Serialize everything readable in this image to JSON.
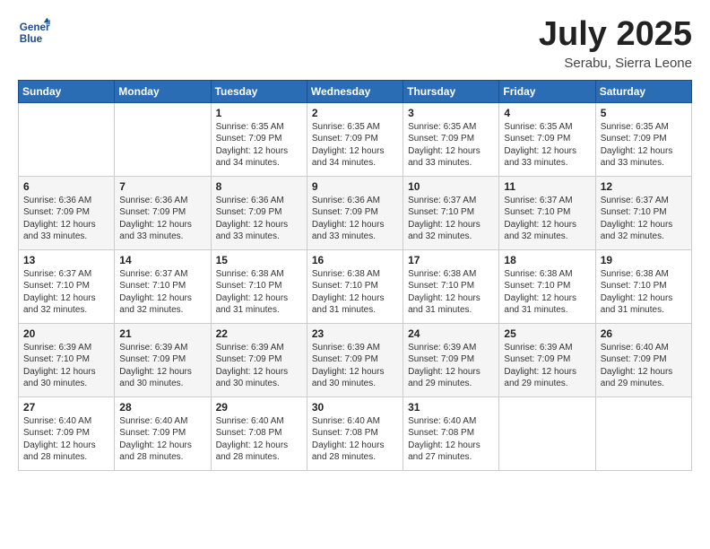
{
  "logo": {
    "line1": "General",
    "line2": "Blue"
  },
  "title": "July 2025",
  "location": "Serabu, Sierra Leone",
  "days_header": [
    "Sunday",
    "Monday",
    "Tuesday",
    "Wednesday",
    "Thursday",
    "Friday",
    "Saturday"
  ],
  "weeks": [
    [
      {
        "day": "",
        "sunrise": "",
        "sunset": "",
        "daylight": ""
      },
      {
        "day": "",
        "sunrise": "",
        "sunset": "",
        "daylight": ""
      },
      {
        "day": "1",
        "sunrise": "Sunrise: 6:35 AM",
        "sunset": "Sunset: 7:09 PM",
        "daylight": "Daylight: 12 hours and 34 minutes."
      },
      {
        "day": "2",
        "sunrise": "Sunrise: 6:35 AM",
        "sunset": "Sunset: 7:09 PM",
        "daylight": "Daylight: 12 hours and 34 minutes."
      },
      {
        "day": "3",
        "sunrise": "Sunrise: 6:35 AM",
        "sunset": "Sunset: 7:09 PM",
        "daylight": "Daylight: 12 hours and 33 minutes."
      },
      {
        "day": "4",
        "sunrise": "Sunrise: 6:35 AM",
        "sunset": "Sunset: 7:09 PM",
        "daylight": "Daylight: 12 hours and 33 minutes."
      },
      {
        "day": "5",
        "sunrise": "Sunrise: 6:35 AM",
        "sunset": "Sunset: 7:09 PM",
        "daylight": "Daylight: 12 hours and 33 minutes."
      }
    ],
    [
      {
        "day": "6",
        "sunrise": "Sunrise: 6:36 AM",
        "sunset": "Sunset: 7:09 PM",
        "daylight": "Daylight: 12 hours and 33 minutes."
      },
      {
        "day": "7",
        "sunrise": "Sunrise: 6:36 AM",
        "sunset": "Sunset: 7:09 PM",
        "daylight": "Daylight: 12 hours and 33 minutes."
      },
      {
        "day": "8",
        "sunrise": "Sunrise: 6:36 AM",
        "sunset": "Sunset: 7:09 PM",
        "daylight": "Daylight: 12 hours and 33 minutes."
      },
      {
        "day": "9",
        "sunrise": "Sunrise: 6:36 AM",
        "sunset": "Sunset: 7:09 PM",
        "daylight": "Daylight: 12 hours and 33 minutes."
      },
      {
        "day": "10",
        "sunrise": "Sunrise: 6:37 AM",
        "sunset": "Sunset: 7:10 PM",
        "daylight": "Daylight: 12 hours and 32 minutes."
      },
      {
        "day": "11",
        "sunrise": "Sunrise: 6:37 AM",
        "sunset": "Sunset: 7:10 PM",
        "daylight": "Daylight: 12 hours and 32 minutes."
      },
      {
        "day": "12",
        "sunrise": "Sunrise: 6:37 AM",
        "sunset": "Sunset: 7:10 PM",
        "daylight": "Daylight: 12 hours and 32 minutes."
      }
    ],
    [
      {
        "day": "13",
        "sunrise": "Sunrise: 6:37 AM",
        "sunset": "Sunset: 7:10 PM",
        "daylight": "Daylight: 12 hours and 32 minutes."
      },
      {
        "day": "14",
        "sunrise": "Sunrise: 6:37 AM",
        "sunset": "Sunset: 7:10 PM",
        "daylight": "Daylight: 12 hours and 32 minutes."
      },
      {
        "day": "15",
        "sunrise": "Sunrise: 6:38 AM",
        "sunset": "Sunset: 7:10 PM",
        "daylight": "Daylight: 12 hours and 31 minutes."
      },
      {
        "day": "16",
        "sunrise": "Sunrise: 6:38 AM",
        "sunset": "Sunset: 7:10 PM",
        "daylight": "Daylight: 12 hours and 31 minutes."
      },
      {
        "day": "17",
        "sunrise": "Sunrise: 6:38 AM",
        "sunset": "Sunset: 7:10 PM",
        "daylight": "Daylight: 12 hours and 31 minutes."
      },
      {
        "day": "18",
        "sunrise": "Sunrise: 6:38 AM",
        "sunset": "Sunset: 7:10 PM",
        "daylight": "Daylight: 12 hours and 31 minutes."
      },
      {
        "day": "19",
        "sunrise": "Sunrise: 6:38 AM",
        "sunset": "Sunset: 7:10 PM",
        "daylight": "Daylight: 12 hours and 31 minutes."
      }
    ],
    [
      {
        "day": "20",
        "sunrise": "Sunrise: 6:39 AM",
        "sunset": "Sunset: 7:10 PM",
        "daylight": "Daylight: 12 hours and 30 minutes."
      },
      {
        "day": "21",
        "sunrise": "Sunrise: 6:39 AM",
        "sunset": "Sunset: 7:09 PM",
        "daylight": "Daylight: 12 hours and 30 minutes."
      },
      {
        "day": "22",
        "sunrise": "Sunrise: 6:39 AM",
        "sunset": "Sunset: 7:09 PM",
        "daylight": "Daylight: 12 hours and 30 minutes."
      },
      {
        "day": "23",
        "sunrise": "Sunrise: 6:39 AM",
        "sunset": "Sunset: 7:09 PM",
        "daylight": "Daylight: 12 hours and 30 minutes."
      },
      {
        "day": "24",
        "sunrise": "Sunrise: 6:39 AM",
        "sunset": "Sunset: 7:09 PM",
        "daylight": "Daylight: 12 hours and 29 minutes."
      },
      {
        "day": "25",
        "sunrise": "Sunrise: 6:39 AM",
        "sunset": "Sunset: 7:09 PM",
        "daylight": "Daylight: 12 hours and 29 minutes."
      },
      {
        "day": "26",
        "sunrise": "Sunrise: 6:40 AM",
        "sunset": "Sunset: 7:09 PM",
        "daylight": "Daylight: 12 hours and 29 minutes."
      }
    ],
    [
      {
        "day": "27",
        "sunrise": "Sunrise: 6:40 AM",
        "sunset": "Sunset: 7:09 PM",
        "daylight": "Daylight: 12 hours and 28 minutes."
      },
      {
        "day": "28",
        "sunrise": "Sunrise: 6:40 AM",
        "sunset": "Sunset: 7:09 PM",
        "daylight": "Daylight: 12 hours and 28 minutes."
      },
      {
        "day": "29",
        "sunrise": "Sunrise: 6:40 AM",
        "sunset": "Sunset: 7:08 PM",
        "daylight": "Daylight: 12 hours and 28 minutes."
      },
      {
        "day": "30",
        "sunrise": "Sunrise: 6:40 AM",
        "sunset": "Sunset: 7:08 PM",
        "daylight": "Daylight: 12 hours and 28 minutes."
      },
      {
        "day": "31",
        "sunrise": "Sunrise: 6:40 AM",
        "sunset": "Sunset: 7:08 PM",
        "daylight": "Daylight: 12 hours and 27 minutes."
      },
      {
        "day": "",
        "sunrise": "",
        "sunset": "",
        "daylight": ""
      },
      {
        "day": "",
        "sunrise": "",
        "sunset": "",
        "daylight": ""
      }
    ]
  ]
}
